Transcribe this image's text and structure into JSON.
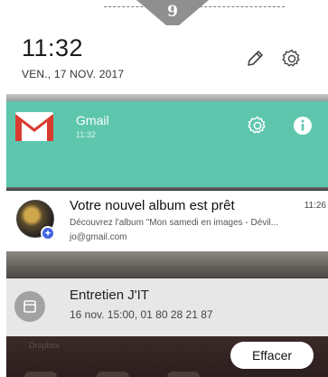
{
  "step": {
    "number": "9"
  },
  "header": {
    "time": "11:32",
    "date": "VEN., 17 NOV. 2017",
    "icons": [
      "edit-icon",
      "settings-icon"
    ]
  },
  "gmail": {
    "app_name": "Gmail",
    "time": "11:32",
    "accent_color": "#5dc6ad"
  },
  "album_notification": {
    "title": "Votre nouvel album est prêt",
    "time": "11:26",
    "description": "Découvrez l'album \"Mon samedi en images - Dévil...",
    "account": "jo@gmail.com"
  },
  "calendar_notification": {
    "title": "Entretien J'IT",
    "details": "16 nov. 15:00, 01 80 28 21 87"
  },
  "bottom": {
    "background_app_label": "Dropbox",
    "clear_button_label": "Effacer"
  }
}
